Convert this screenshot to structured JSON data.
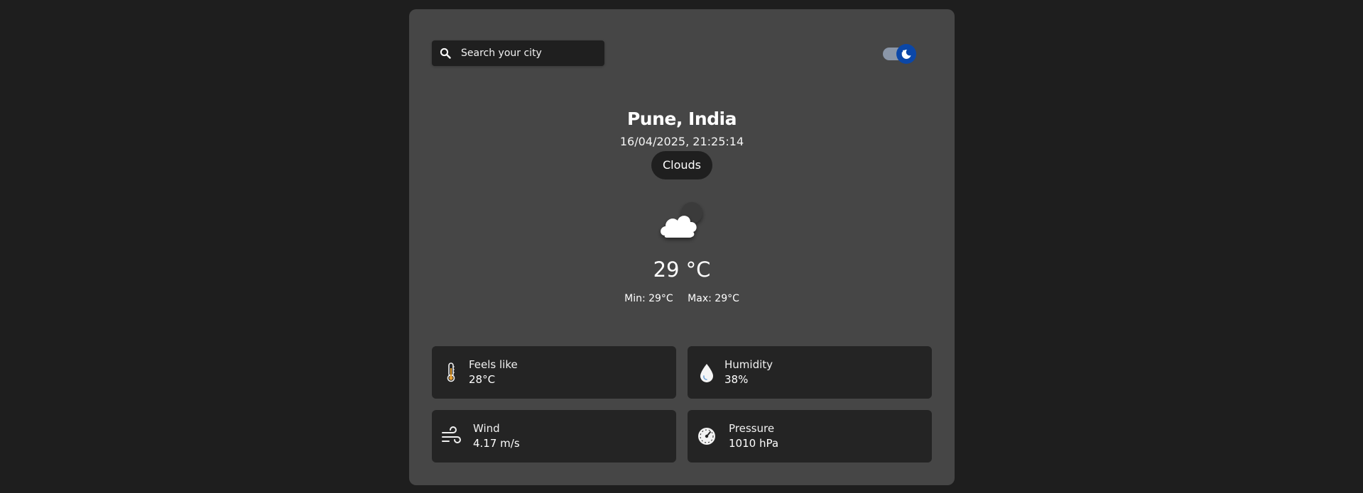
{
  "search": {
    "placeholder": "Search your city",
    "value": ""
  },
  "theme_toggle": {
    "state": "dark"
  },
  "location": {
    "name": "Pune, India",
    "datetime": "16/04/2025, 21:25:14"
  },
  "weather": {
    "condition": "Clouds",
    "icon": "cloud-night-icon",
    "temperature": "29 °C",
    "min": "Min: 29°C",
    "max": "Max: 29°C"
  },
  "details": {
    "feels_like": {
      "label": "Feels like",
      "value": "28°C",
      "icon": "thermometer-icon"
    },
    "humidity": {
      "label": "Humidity",
      "value": "38%",
      "icon": "droplet-icon"
    },
    "wind": {
      "label": "Wind",
      "value": "4.17 m/s",
      "icon": "wind-icon"
    },
    "pressure": {
      "label": "Pressure",
      "value": "1010 hPa",
      "icon": "gauge-icon"
    }
  },
  "colors": {
    "page_bg": "#1e1e1e",
    "card_bg": "#464646",
    "tile_bg": "#242424",
    "toggle_knob": "#0b47a8"
  }
}
